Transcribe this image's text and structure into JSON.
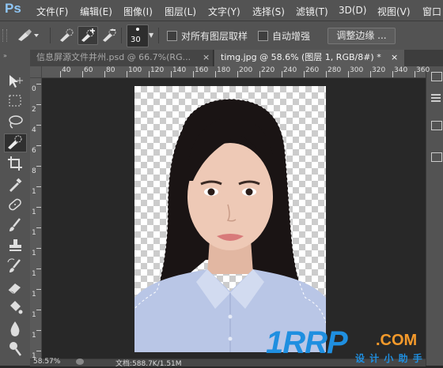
{
  "app": {
    "logo": "Ps"
  },
  "menu": [
    "文件(F)",
    "编辑(E)",
    "图像(I)",
    "图层(L)",
    "文字(Y)",
    "选择(S)",
    "滤镜(T)",
    "3D(D)",
    "视图(V)",
    "窗口"
  ],
  "options": {
    "brush_size": "30",
    "sample_all_layers": "对所有图层取样",
    "auto_enhance": "自动增强",
    "refine_edge": "调整边缘 ..."
  },
  "tabs": [
    {
      "label": "信息屏源文件井州.psd @ 66.7%(RG..."
    },
    {
      "label": "timg.jpg @ 58.6% (图层 1, RGB/8#) *"
    }
  ],
  "ruler_h": [
    "40",
    "60",
    "80",
    "100",
    "120",
    "140",
    "160",
    "180",
    "200",
    "220",
    "240",
    "260",
    "280",
    "300",
    "320",
    "340",
    "360"
  ],
  "ruler_v": [
    "0",
    "2",
    "4",
    "6",
    "8",
    "1",
    "1",
    "1",
    "1",
    "1",
    "1",
    "1",
    "1",
    "1"
  ],
  "status": {
    "zoom": "58.57%",
    "doc": "文档:588.7K/1.51M"
  },
  "watermark": {
    "brand": "1RRP",
    "suffix": ".COM",
    "tagline": "设 计 小 助 手"
  },
  "colors": {
    "accent": "#8fc6f5",
    "watermark_blue": "#1f8fe0",
    "watermark_orange": "#f59a2b",
    "shirt": "#b9c6e6",
    "hair": "#1a1414",
    "skin": "#eec9b6"
  },
  "icons": [
    "move-icon",
    "marquee-icon",
    "lasso-icon",
    "quick-selection-icon",
    "crop-icon",
    "eyedropper-icon",
    "healing-brush-icon",
    "brush-icon",
    "clone-stamp-icon",
    "history-brush-icon",
    "eraser-icon",
    "paint-bucket-icon",
    "blur-icon",
    "dodge-icon"
  ]
}
